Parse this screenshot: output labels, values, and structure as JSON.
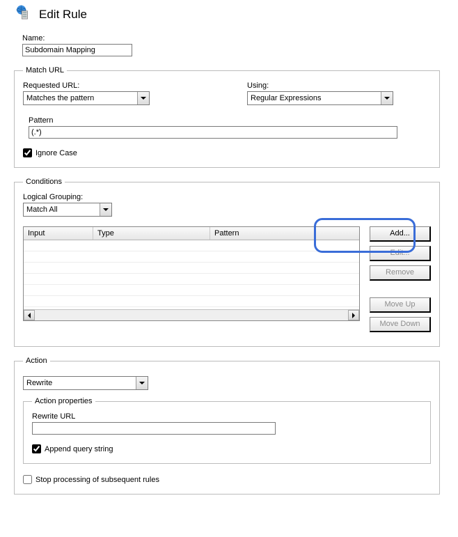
{
  "header": {
    "title": "Edit Rule"
  },
  "name": {
    "label": "Name:",
    "value": "Subdomain Mapping"
  },
  "matchUrl": {
    "legend": "Match URL",
    "requestedLabel": "Requested URL:",
    "requestedValue": "Matches the pattern",
    "usingLabel": "Using:",
    "usingValue": "Regular Expressions",
    "patternLabel": "Pattern",
    "patternValue": "(.*)",
    "ignoreCaseLabel": "Ignore Case",
    "ignoreCaseChecked": true
  },
  "conditions": {
    "legend": "Conditions",
    "groupingLabel": "Logical Grouping:",
    "groupingValue": "Match All",
    "columns": {
      "input": "Input",
      "type": "Type",
      "pattern": "Pattern"
    },
    "buttons": {
      "add": "Add...",
      "edit": "Edit...",
      "remove": "Remove",
      "moveUp": "Move Up",
      "moveDown": "Move Down"
    }
  },
  "action": {
    "legend": "Action",
    "typeValue": "Rewrite",
    "propsLegend": "Action properties",
    "rewriteLabel": "Rewrite URL",
    "rewriteValue": "",
    "appendLabel": "Append query string",
    "appendChecked": true,
    "stopLabel": "Stop processing of subsequent rules",
    "stopChecked": false
  }
}
